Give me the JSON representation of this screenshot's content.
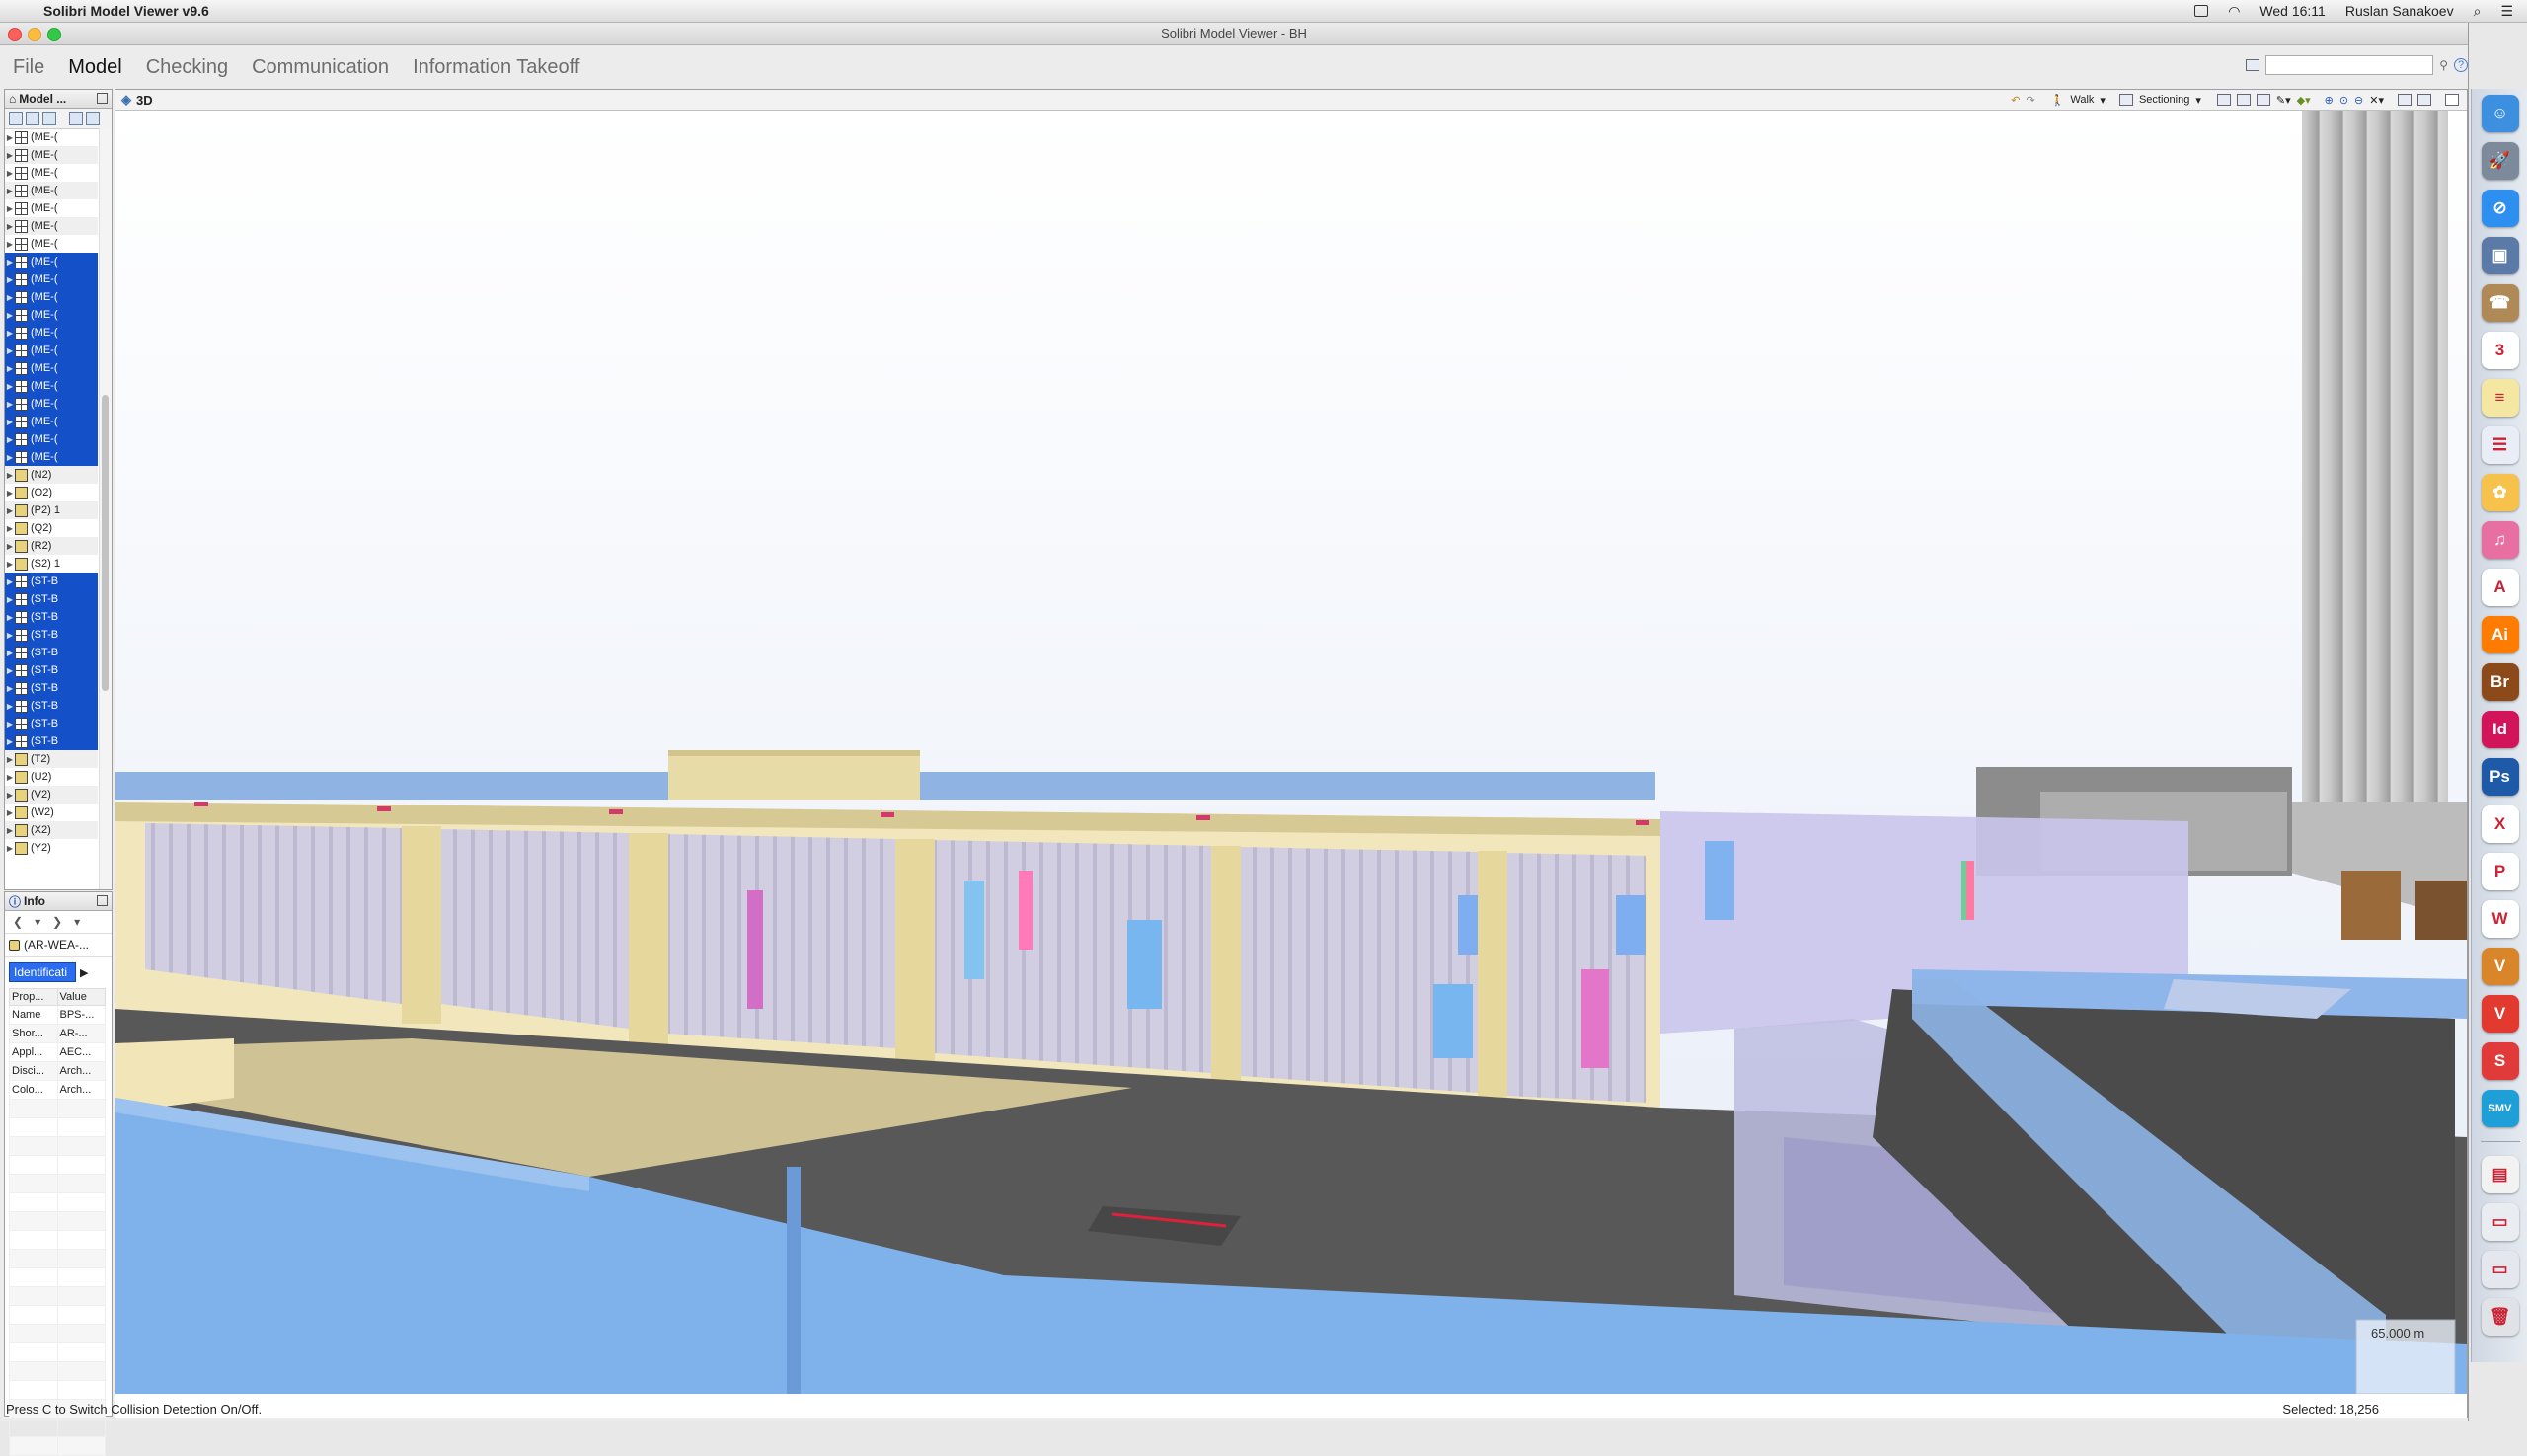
{
  "menubar": {
    "app_name": "Solibri Model Viewer v9.6",
    "clock": "Wed 16:11",
    "user": "Ruslan Sanakoev"
  },
  "window": {
    "title": "Solibri Model Viewer - BH"
  },
  "app_menu": {
    "items": [
      "File",
      "Model",
      "Checking",
      "Communication",
      "Information Takeoff"
    ],
    "active": "Model"
  },
  "model_panel": {
    "title": "Model ...",
    "rows": [
      {
        "label": "(ME-(",
        "icon": "grid",
        "selected": false
      },
      {
        "label": "(ME-(",
        "icon": "grid",
        "selected": false
      },
      {
        "label": "(ME-(",
        "icon": "grid",
        "selected": false
      },
      {
        "label": "(ME-(",
        "icon": "grid",
        "selected": false
      },
      {
        "label": "(ME-(",
        "icon": "grid",
        "selected": false
      },
      {
        "label": "(ME-(",
        "icon": "grid",
        "selected": false
      },
      {
        "label": "(ME-(",
        "icon": "grid",
        "selected": false
      },
      {
        "label": "(ME-(",
        "icon": "grid",
        "selected": true
      },
      {
        "label": "(ME-(",
        "icon": "grid",
        "selected": true
      },
      {
        "label": "(ME-(",
        "icon": "grid",
        "selected": true
      },
      {
        "label": "(ME-(",
        "icon": "grid",
        "selected": true
      },
      {
        "label": "(ME-(",
        "icon": "grid",
        "selected": true
      },
      {
        "label": "(ME-(",
        "icon": "grid",
        "selected": true
      },
      {
        "label": "(ME-(",
        "icon": "grid",
        "selected": true
      },
      {
        "label": "(ME-(",
        "icon": "grid",
        "selected": true
      },
      {
        "label": "(ME-(",
        "icon": "grid",
        "selected": true
      },
      {
        "label": "(ME-(",
        "icon": "grid",
        "selected": true
      },
      {
        "label": "(ME-(",
        "icon": "grid",
        "selected": true
      },
      {
        "label": "(ME-(",
        "icon": "grid",
        "selected": true
      },
      {
        "label": "(N2)",
        "icon": "box",
        "selected": false
      },
      {
        "label": "(O2)",
        "icon": "box",
        "selected": false
      },
      {
        "label": "(P2) 1",
        "icon": "box",
        "selected": false
      },
      {
        "label": "(Q2)",
        "icon": "box",
        "selected": false
      },
      {
        "label": "(R2)",
        "icon": "box",
        "selected": false
      },
      {
        "label": "(S2) 1",
        "icon": "box",
        "selected": false
      },
      {
        "label": "(ST-B",
        "icon": "grid",
        "selected": true
      },
      {
        "label": "(ST-B",
        "icon": "grid",
        "selected": true
      },
      {
        "label": "(ST-B",
        "icon": "grid",
        "selected": true
      },
      {
        "label": "(ST-B",
        "icon": "grid",
        "selected": true
      },
      {
        "label": "(ST-B",
        "icon": "grid",
        "selected": true
      },
      {
        "label": "(ST-B",
        "icon": "grid",
        "selected": true
      },
      {
        "label": "(ST-B",
        "icon": "grid",
        "selected": true
      },
      {
        "label": "(ST-B",
        "icon": "grid",
        "selected": true
      },
      {
        "label": "(ST-B",
        "icon": "grid",
        "selected": true
      },
      {
        "label": "(ST-B",
        "icon": "grid",
        "selected": true
      },
      {
        "label": "(T2)",
        "icon": "box",
        "selected": false
      },
      {
        "label": "(U2)",
        "icon": "box",
        "selected": false
      },
      {
        "label": "(V2)",
        "icon": "box",
        "selected": false
      },
      {
        "label": "(W2)",
        "icon": "box",
        "selected": false
      },
      {
        "label": "(X2)",
        "icon": "box",
        "selected": false
      },
      {
        "label": "(Y2)",
        "icon": "box",
        "selected": false
      }
    ]
  },
  "info_panel": {
    "title": "Info",
    "selected_object": "(AR-WEA-...",
    "tab_label": "Identificati",
    "columns": [
      "Prop...",
      "Value"
    ],
    "rows": [
      {
        "prop": "Name",
        "value": "BPS-..."
      },
      {
        "prop": "Shor...",
        "value": "AR-..."
      },
      {
        "prop": "Appl...",
        "value": "AEC..."
      },
      {
        "prop": "Disci...",
        "value": "Arch..."
      },
      {
        "prop": "Colo...",
        "value": "Arch..."
      }
    ]
  },
  "view3d": {
    "title": "3D",
    "walk_label": "Walk",
    "sectioning_label": "Sectioning",
    "distance": "65.000 m"
  },
  "status": {
    "hint": "Press C to Switch Collision Detection On/Off.",
    "selected": "Selected: 18,256"
  },
  "dock": {
    "items": [
      {
        "name": "finder-icon",
        "text": "☺",
        "color": "#3d8fe0"
      },
      {
        "name": "launchpad-icon",
        "text": "🚀",
        "color": "#7c8a9c"
      },
      {
        "name": "safari-icon",
        "text": "⊘",
        "color": "#2d8ff0"
      },
      {
        "name": "preview-icon",
        "text": "▣",
        "color": "#5b7aa8"
      },
      {
        "name": "contacts-icon",
        "text": "☎",
        "color": "#b08a56"
      },
      {
        "name": "calendar-icon",
        "text": "3",
        "color": "#ffffff"
      },
      {
        "name": "notes-icon",
        "text": "≡",
        "color": "#f4e7a1"
      },
      {
        "name": "reminders-icon",
        "text": "☰",
        "color": "#e9eef6"
      },
      {
        "name": "photos-icon",
        "text": "✿",
        "color": "#f6c24b"
      },
      {
        "name": "itunes-icon",
        "text": "♫",
        "color": "#e86fa2"
      },
      {
        "name": "acrobat-icon",
        "text": "A",
        "color": "#ffffff"
      },
      {
        "name": "illustrator-icon",
        "text": "Ai",
        "color": "#ff7c00"
      },
      {
        "name": "bridge-icon",
        "text": "Br",
        "color": "#8c4a1b"
      },
      {
        "name": "indesign-icon",
        "text": "Id",
        "color": "#d2145a"
      },
      {
        "name": "photoshop-icon",
        "text": "Ps",
        "color": "#1f5aa8"
      },
      {
        "name": "excel-icon",
        "text": "X",
        "color": "#ffffff"
      },
      {
        "name": "powerpoint-icon",
        "text": "P",
        "color": "#ffffff"
      },
      {
        "name": "word-icon",
        "text": "W",
        "color": "#ffffff"
      },
      {
        "name": "vectorworks-icon",
        "text": "V",
        "color": "#d9862b"
      },
      {
        "name": "vivaldi-icon",
        "text": "V",
        "color": "#e33a2f"
      },
      {
        "name": "sketchup-icon",
        "text": "S",
        "color": "#e03a3a"
      },
      {
        "name": "smv-icon",
        "text": "SMV",
        "color": "#1f9fd8"
      },
      {
        "name": "document-icon",
        "text": "▤",
        "color": "#f2f2f2"
      },
      {
        "name": "scanner-icon",
        "text": "▭",
        "color": "#e9edf2"
      },
      {
        "name": "printer-icon",
        "text": "▭",
        "color": "#e4e8ee"
      },
      {
        "name": "trash-icon",
        "text": "🗑",
        "color": "#dfe3e8"
      }
    ]
  }
}
